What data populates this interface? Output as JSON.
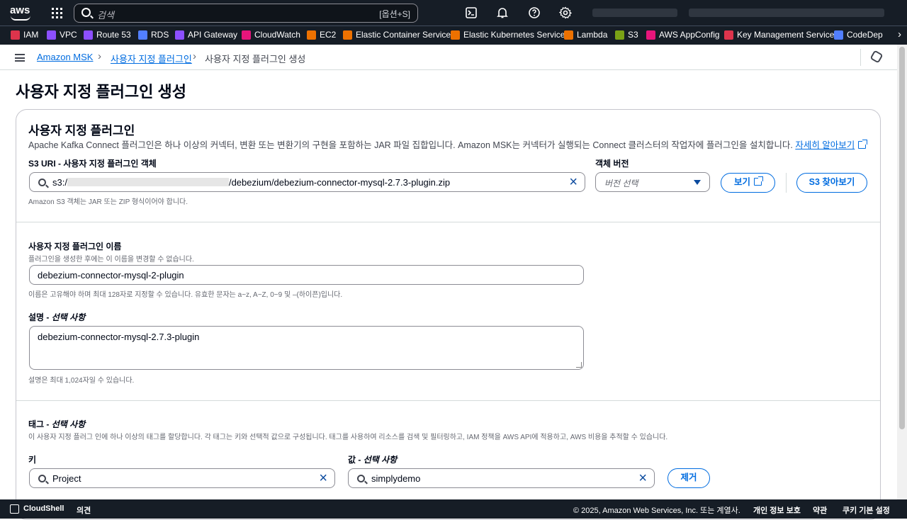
{
  "topnav": {
    "logo": "aws",
    "search_placeholder": "검색",
    "search_shortcut": "[옵션+S]"
  },
  "favorites": [
    {
      "label": "IAM",
      "color": "#dd344c"
    },
    {
      "label": "VPC",
      "color": "#8c4fff"
    },
    {
      "label": "Route 53",
      "color": "#8c4fff"
    },
    {
      "label": "RDS",
      "color": "#527fff"
    },
    {
      "label": "API Gateway",
      "color": "#8c4fff"
    },
    {
      "label": "CloudWatch",
      "color": "#e7157b"
    },
    {
      "label": "EC2",
      "color": "#ed7100"
    },
    {
      "label": "Elastic Container Service",
      "color": "#ed7100"
    },
    {
      "label": "Elastic Kubernetes Service",
      "color": "#ed7100"
    },
    {
      "label": "Lambda",
      "color": "#ed7100"
    },
    {
      "label": "S3",
      "color": "#7aa116"
    },
    {
      "label": "AWS AppConfig",
      "color": "#e7157b"
    },
    {
      "label": "Key Management Service",
      "color": "#dd344c"
    },
    {
      "label": "CodeDep",
      "color": "#527fff"
    }
  ],
  "breadcrumb": {
    "item1": "Amazon MSK",
    "item2": "사용자 지정 플러그인",
    "current": "사용자 지정 플러그인 생성"
  },
  "page_title": "사용자 지정 플러그인 생성",
  "plugin_section": {
    "title": "사용자 지정 플러그인",
    "description": "Apache Kafka Connect 플러그인은 하나 이상의 커넥터, 변환 또는 변환기의 구현을 포함하는 JAR 파일 집합입니다. Amazon MSK는 커넥터가 실행되는 Connect 클러스터의 작업자에 플러그인을 설치합니다.",
    "learn_more": "자세히 알아보기",
    "s3_label": "S3 URI - 사용자 지정 플러그인 객체",
    "s3_prefix": "s3:/",
    "s3_suffix": "/debezium/debezium-connector-mysql-2.7.3-plugin.zip",
    "s3_hint": "Amazon S3 객체는 JAR 또는 ZIP 형식이어야 합니다.",
    "version_label": "객체 버전",
    "version_placeholder": "버전 선택",
    "view_button": "보기",
    "browse_button": "S3 찾아보기",
    "name_label": "사용자 지정 플러그인 이름",
    "name_subhint": "플러그인을 생성한 후에는 이 이름을 변경할 수 없습니다.",
    "name_value": "debezium-connector-mysql-2-plugin",
    "name_hint": "이름은 고유해야 하며 최대 128자로 지정할 수 있습니다. 유효한 문자는 a~z, A~Z, 0~9 및 –(하이픈)입니다.",
    "desc_label": "설명",
    "desc_optional": "선택 사항",
    "desc_value": "debezium-connector-mysql-2.7.3-plugin",
    "desc_hint": "설명은 최대 1,024자일 수 있습니다."
  },
  "tags_section": {
    "label": "태그",
    "optional": "선택 사항",
    "description": "이 사용자 지정 플러그 인에 하나 이상의 태그를 할당합니다. 각 태그는 키와 선택적 값으로 구성됩니다. 태그를 사용하여 리소스를 검색 및 필터링하고, IAM 정책을 AWS API에 적용하고, AWS 비용을 추적할 수 있습니다.",
    "key_label": "키",
    "value_label": "값",
    "key_value": "Project",
    "value_value": "simplydemo",
    "remove_button": "제거"
  },
  "footer": {
    "cloudshell": "CloudShell",
    "feedback": "의견",
    "copyright": "© 2025, Amazon Web Services, Inc. 또는 계열사.",
    "privacy": "개인 정보 보호",
    "terms": "약관",
    "cookies": "쿠키 기본 설정"
  }
}
